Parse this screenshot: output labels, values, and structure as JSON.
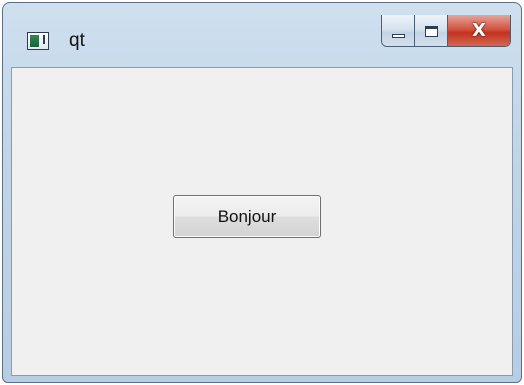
{
  "window": {
    "title": "qt"
  },
  "titlebar": {
    "icon": "qt-app-window-icon",
    "buttons": {
      "minimize_icon": "minimize-icon",
      "maximize_icon": "maximize-icon",
      "close_icon": "close-icon",
      "close_glyph": "X"
    }
  },
  "main": {
    "button_label": "Bonjour"
  },
  "colors": {
    "client_background": "#f0f0f0",
    "close_button": "#c2331f"
  }
}
